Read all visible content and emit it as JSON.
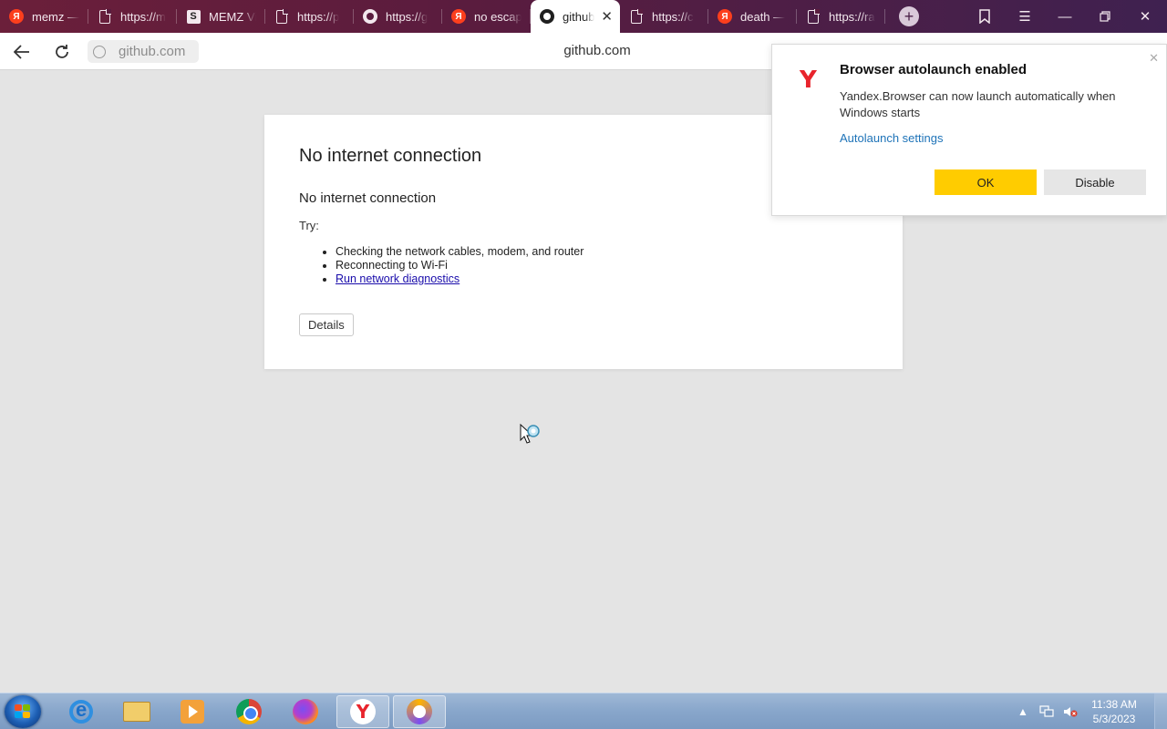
{
  "tabs": [
    {
      "label": "memz —",
      "icon": "yandex-icon",
      "active": false
    },
    {
      "label": "https://m",
      "icon": "document-icon",
      "active": false
    },
    {
      "label": "MEMZ Vi",
      "icon": "memz-icon",
      "active": false
    },
    {
      "label": "https://p",
      "icon": "document-icon",
      "active": false
    },
    {
      "label": "https://g",
      "icon": "github-icon",
      "active": false
    },
    {
      "label": "no escap",
      "icon": "yandex-icon",
      "active": false
    },
    {
      "label": "github",
      "icon": "github-icon",
      "active": true
    },
    {
      "label": "https://c",
      "icon": "document-icon",
      "active": false
    },
    {
      "label": "death —",
      "icon": "yandex-icon",
      "active": false
    },
    {
      "label": "https://ra",
      "icon": "document-icon",
      "active": false
    }
  ],
  "toolbar": {
    "address": "github.com",
    "page_title": "github.com"
  },
  "error": {
    "heading": "No internet connection",
    "subheading": "No internet connection",
    "try_label": "Try:",
    "suggestions": [
      "Checking the network cables, modem, and router",
      "Reconnecting to Wi-Fi"
    ],
    "diagnostics_link": "Run network diagnostics",
    "details_button": "Details"
  },
  "notification": {
    "title": "Browser autolaunch enabled",
    "body": "Yandex.Browser can now launch automatically when Windows starts",
    "link": "Autolaunch settings",
    "ok_button": "OK",
    "disable_button": "Disable",
    "accent_color": "#ffcc00"
  },
  "taskbar": {
    "apps": [
      "internet-explorer",
      "file-explorer",
      "media-player",
      "chrome",
      "firefox",
      "yandex-browser",
      "vpn"
    ],
    "time": "11:38 AM",
    "date": "5/3/2023"
  }
}
